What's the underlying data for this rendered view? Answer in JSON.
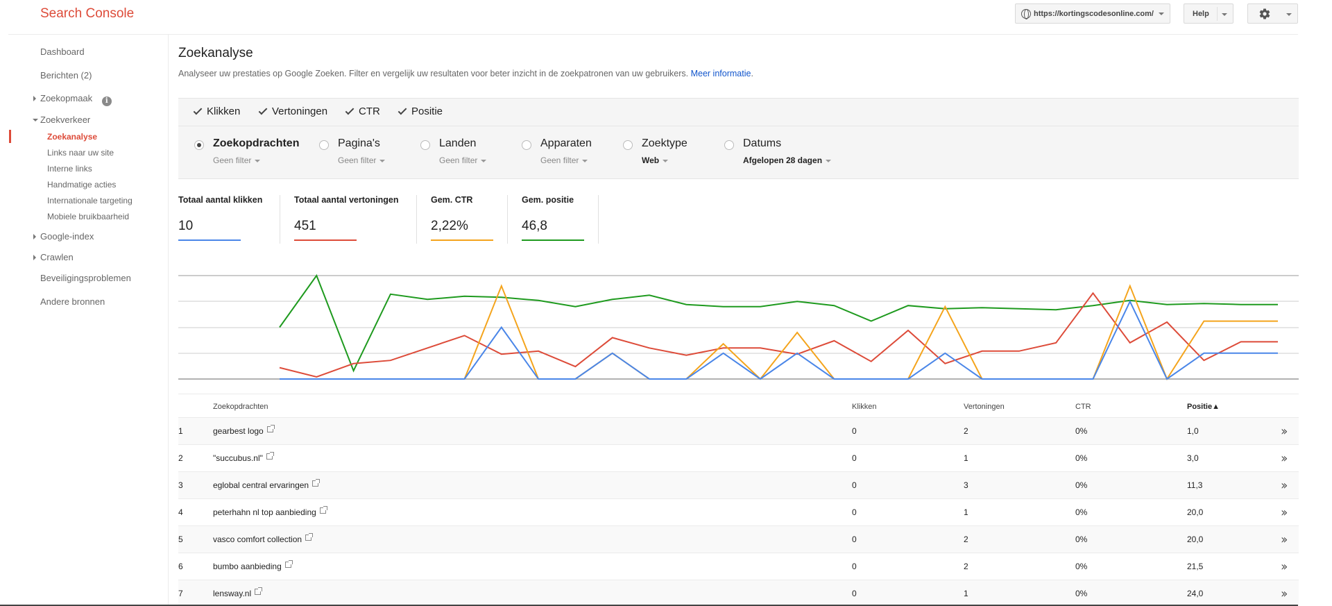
{
  "header": {
    "brand": "Search Console",
    "site_url": "https://kortingscodesonline.com/",
    "help_label": "Help",
    "accent": "#dd4b39"
  },
  "sidebar": {
    "dashboard": "Dashboard",
    "berichten": "Berichten (2)",
    "zoekopmaak": "Zoekopmaak",
    "zoekverkeer": "Zoekverkeer",
    "sub": [
      "Zoekanalyse",
      "Links naar uw site",
      "Interne links",
      "Handmatige acties",
      "Internationale targeting",
      "Mobiele bruikbaarheid"
    ],
    "google_index": "Google-index",
    "crawlen": "Crawlen",
    "beveiliging": "Beveiligingsproblemen",
    "andere": "Andere bronnen"
  },
  "main": {
    "title": "Zoekanalyse",
    "description": "Analyseer uw prestaties op Google Zoeken. Filter en vergelijk uw resultaten voor beter inzicht in de zoekpatronen van uw gebruikers.",
    "more_link": "Meer informatie",
    "metrics": [
      "Klikken",
      "Vertoningen",
      "CTR",
      "Positie"
    ],
    "groups": [
      {
        "label": "Zoekopdrachten",
        "filter": "Geen filter",
        "selected": true
      },
      {
        "label": "Pagina's",
        "filter": "Geen filter",
        "selected": false
      },
      {
        "label": "Landen",
        "filter": "Geen filter",
        "selected": false
      },
      {
        "label": "Apparaten",
        "filter": "Geen filter",
        "selected": false
      },
      {
        "label": "Zoektype",
        "filter": "Web",
        "selected": false
      },
      {
        "label": "Datums",
        "filter": "Afgelopen 28 dagen",
        "selected": false
      }
    ],
    "totals": [
      {
        "label": "Totaal aantal klikken",
        "value": "10",
        "color": "#4a86e8"
      },
      {
        "label": "Totaal aantal vertoningen",
        "value": "451",
        "color": "#dd4b39"
      },
      {
        "label": "Gem. CTR",
        "value": "2,22%",
        "color": "#f4a41c"
      },
      {
        "label": "Gem. positie",
        "value": "46,8",
        "color": "#1e9a1e"
      }
    ]
  },
  "chart_data": {
    "type": "line",
    "x": [
      1,
      2,
      3,
      4,
      5,
      6,
      7,
      8,
      9,
      10,
      11,
      12,
      13,
      14,
      15,
      16,
      17,
      18,
      19,
      20,
      21,
      22,
      23,
      24,
      25,
      26,
      27,
      28
    ],
    "series": [
      {
        "color": "#1e9a1e",
        "values": [
          0.5,
          1.0,
          0.08,
          0.82,
          0.77,
          0.8,
          0.79,
          0.76,
          0.7,
          0.77,
          0.81,
          0.72,
          0.7,
          0.7,
          0.75,
          0.71,
          0.56,
          0.71,
          0.68,
          0.69,
          0.68,
          0.67,
          0.71,
          0.76,
          0.72,
          0.73,
          0.72,
          0.72
        ]
      },
      {
        "color": "#dd4b39",
        "values": [
          0.11,
          0.02,
          0.15,
          0.18,
          0.3,
          0.42,
          0.24,
          0.27,
          0.12,
          0.4,
          0.3,
          0.23,
          0.3,
          0.3,
          0.24,
          0.37,
          0.17,
          0.47,
          0.15,
          0.27,
          0.27,
          0.35,
          0.83,
          0.35,
          0.55,
          0.18,
          0.36,
          0.36
        ]
      },
      {
        "color": "#f4a41c",
        "values": [
          0.0,
          0.0,
          0.0,
          0.0,
          0.0,
          0.0,
          0.9,
          0.0,
          0.0,
          0.25,
          0.0,
          0.0,
          0.34,
          0.0,
          0.45,
          0.0,
          0.0,
          0.0,
          0.7,
          0.0,
          0.0,
          0.0,
          0.0,
          0.9,
          0.0,
          0.56,
          0.56,
          0.56
        ]
      },
      {
        "color": "#4a86e8",
        "values": [
          0.0,
          0.0,
          0.0,
          0.0,
          0.0,
          0.0,
          0.5,
          0.0,
          0.0,
          0.25,
          0.0,
          0.0,
          0.25,
          0.0,
          0.25,
          0.0,
          0.0,
          0.0,
          0.25,
          0.0,
          0.0,
          0.0,
          0.0,
          0.75,
          0.0,
          0.25,
          0.25,
          0.25
        ]
      }
    ]
  },
  "table": {
    "headers": {
      "query": "Zoekopdrachten",
      "clicks": "Klikken",
      "impressions": "Vertoningen",
      "ctr": "CTR",
      "position": "Positie▲"
    },
    "rows": [
      {
        "n": "1",
        "q": "gearbest logo",
        "c": "0",
        "i": "2",
        "ctr": "0%",
        "p": "1,0"
      },
      {
        "n": "2",
        "q": "\"succubus.nl\"",
        "c": "0",
        "i": "1",
        "ctr": "0%",
        "p": "3,0"
      },
      {
        "n": "3",
        "q": "eglobal central ervaringen",
        "c": "0",
        "i": "3",
        "ctr": "0%",
        "p": "11,3"
      },
      {
        "n": "4",
        "q": "peterhahn nl top aanbieding",
        "c": "0",
        "i": "1",
        "ctr": "0%",
        "p": "20,0"
      },
      {
        "n": "5",
        "q": "vasco comfort collection",
        "c": "0",
        "i": "2",
        "ctr": "0%",
        "p": "20,0"
      },
      {
        "n": "6",
        "q": "bumbo aanbieding",
        "c": "0",
        "i": "2",
        "ctr": "0%",
        "p": "21,5"
      },
      {
        "n": "7",
        "q": "lensway.nl",
        "c": "0",
        "i": "1",
        "ctr": "0%",
        "p": "24,0"
      }
    ]
  }
}
